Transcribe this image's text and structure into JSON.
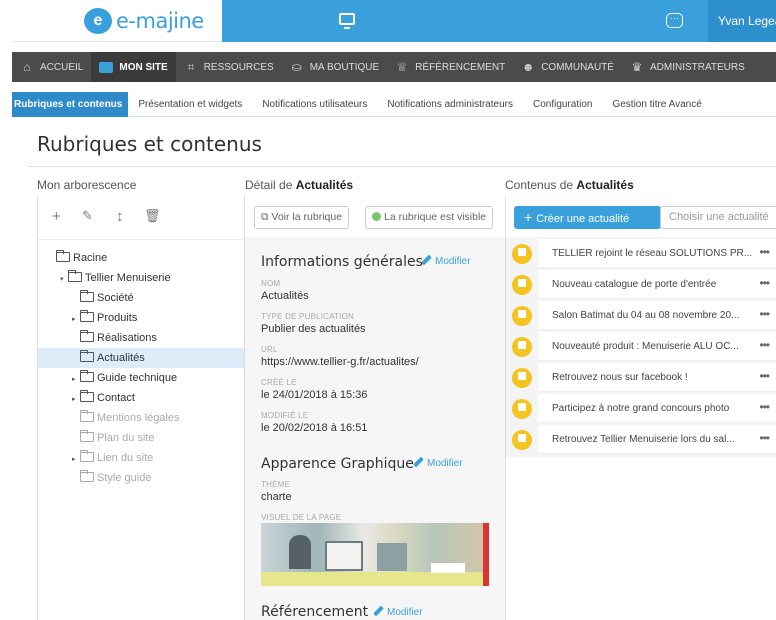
{
  "header": {
    "logo_mark": "e",
    "logo_text": "e-majine",
    "user_name": "Yvan Legeay",
    "icons": [
      "monitor-icon",
      "chat-icon"
    ]
  },
  "main_nav": [
    {
      "label": "Accueil",
      "icon": "home-icon",
      "glyph": "⌂",
      "active": false
    },
    {
      "label": "Mon site",
      "icon": "monitor-icon",
      "glyph": "",
      "active": true
    },
    {
      "label": "Ressources",
      "icon": "crop-icon",
      "glyph": "⌗",
      "active": false
    },
    {
      "label": "Ma boutique",
      "icon": "basket-icon",
      "glyph": "⛀",
      "active": false
    },
    {
      "label": "Référencement",
      "icon": "trophy-icon",
      "glyph": "♕",
      "active": false
    },
    {
      "label": "Communauté",
      "icon": "users-icon",
      "glyph": "☻",
      "active": false
    },
    {
      "label": "Administrateurs",
      "icon": "crown-icon",
      "glyph": "♛",
      "active": false
    }
  ],
  "sub_nav": [
    {
      "label": "Rubriques et contenus",
      "active": true
    },
    {
      "label": "Présentation et widgets",
      "active": false
    },
    {
      "label": "Notifications utilisateurs",
      "active": false
    },
    {
      "label": "Notifications administrateurs",
      "active": false
    },
    {
      "label": "Configuration",
      "active": false
    },
    {
      "label": "Gestion titre Avancé",
      "active": false
    }
  ],
  "page_title": "Rubriques et contenus",
  "tree_column": {
    "title": "Mon arborescence",
    "tools": [
      "add-icon",
      "edit-icon",
      "move-icon",
      "delete-icon"
    ],
    "items": [
      {
        "label": "Racine",
        "level": 0,
        "caret": "",
        "dim": false,
        "selected": false
      },
      {
        "label": "Tellier Menuiserie",
        "level": 1,
        "caret": "▾",
        "dim": false,
        "selected": false
      },
      {
        "label": "Société",
        "level": 2,
        "caret": "",
        "dim": false,
        "selected": false
      },
      {
        "label": "Produits",
        "level": 2,
        "caret": "▸",
        "dim": false,
        "selected": false
      },
      {
        "label": "Réalisations",
        "level": 2,
        "caret": "",
        "dim": false,
        "selected": false
      },
      {
        "label": "Actualités",
        "level": 2,
        "caret": "",
        "dim": false,
        "selected": true
      },
      {
        "label": "Guide technique",
        "level": 2,
        "caret": "▸",
        "dim": false,
        "selected": false
      },
      {
        "label": "Contact",
        "level": 2,
        "caret": "▸",
        "dim": false,
        "selected": false
      },
      {
        "label": "Mentions légales",
        "level": 2,
        "caret": "",
        "dim": true,
        "selected": false
      },
      {
        "label": "Plan du site",
        "level": 2,
        "caret": "",
        "dim": true,
        "selected": false
      },
      {
        "label": "Lien du site",
        "level": 2,
        "caret": "▸",
        "dim": true,
        "selected": false
      },
      {
        "label": "Style guide",
        "level": 2,
        "caret": "",
        "dim": true,
        "selected": false
      }
    ]
  },
  "detail_column": {
    "title_prefix": "Détail de",
    "title_bold": "Actualités",
    "view_button": "Voir la rubrique",
    "visible_button": "La rubrique est visible",
    "modify_label": "Modifier",
    "general_title": "Informations générales",
    "fields": [
      {
        "label": "Nom",
        "value": "Actualités"
      },
      {
        "label": "Type de publication",
        "value": "Publier des actualités"
      },
      {
        "label": "URL",
        "value": "https://www.tellier-g.fr/actualites/"
      },
      {
        "label": "Créé le",
        "value": "le 24/01/2018 à 15:36"
      },
      {
        "label": "Modifié le",
        "value": "le 20/02/2018 à 16:51"
      }
    ],
    "appearance_title": "Apparence Graphique",
    "theme_label": "Thème",
    "theme_value": "charte",
    "visual_label": "Visuel de la page",
    "seo_title": "Référencement"
  },
  "content_column": {
    "title_prefix": "Contenus de",
    "title_bold": "Actualités",
    "create_button": "Créer une actualité",
    "choose_button": "Choisir une actualité",
    "items": [
      "TELLIER rejoint le réseau SOLUTIONS PR...",
      "Nouveau catalogue de porte d'entrée",
      "Salon Batimat du 04 au 08 novembre 20...",
      "Nouveauté produit : Menuiserie ALU OC...",
      "Retrouvez nous sur facebook !",
      "Participez à notre grand concours photo",
      "Retrouvez Tellier Menuiserie lors du sal..."
    ],
    "more_glyph": "•••"
  },
  "colors": {
    "brand_blue": "#3aa0dc",
    "nav_dark": "#4b4b4b",
    "news_badge": "#f4c521",
    "selected_row": "#dcecf8"
  }
}
